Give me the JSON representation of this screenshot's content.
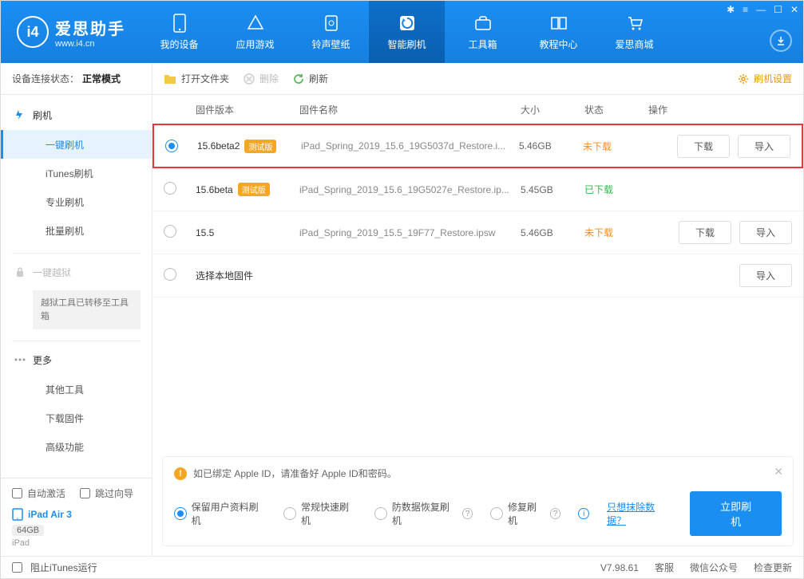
{
  "app": {
    "title": "爱思助手",
    "url": "www.i4.cn"
  },
  "window_buttons": [
    "✱",
    "≡",
    "—",
    "☐",
    "✕"
  ],
  "nav": [
    {
      "label": "我的设备"
    },
    {
      "label": "应用游戏"
    },
    {
      "label": "铃声壁纸"
    },
    {
      "label": "智能刷机",
      "active": true
    },
    {
      "label": "工具箱"
    },
    {
      "label": "教程中心"
    },
    {
      "label": "爱思商城"
    }
  ],
  "status": {
    "prefix": "设备连接状态：",
    "value": "正常模式"
  },
  "sidebar": {
    "group1": {
      "title": "刷机",
      "items": [
        "一键刷机",
        "iTunes刷机",
        "专业刷机",
        "批量刷机"
      ],
      "active": 0
    },
    "jailbreak": {
      "title": "一键越狱",
      "note": "越狱工具已转移至工具箱"
    },
    "more": {
      "title": "更多",
      "items": [
        "其他工具",
        "下载固件",
        "高级功能"
      ]
    },
    "auto_activate": "自动激活",
    "skip_guide": "跳过向导",
    "device": {
      "name": "iPad Air 3",
      "storage": "64GB",
      "type": "iPad"
    }
  },
  "toolbar": {
    "open": "打开文件夹",
    "delete": "删除",
    "refresh": "刷新",
    "settings": "刷机设置"
  },
  "table": {
    "headers": {
      "version": "固件版本",
      "name": "固件名称",
      "size": "大小",
      "status": "状态",
      "ops": "操作"
    },
    "rows": [
      {
        "selected": true,
        "version": "15.6beta2",
        "beta": "测试版",
        "name": "iPad_Spring_2019_15.6_19G5037d_Restore.i...",
        "size": "5.46GB",
        "status": "未下载",
        "status_class": "st-not",
        "download": "下载",
        "import": "导入",
        "highlight": true
      },
      {
        "selected": false,
        "version": "15.6beta",
        "beta": "测试版",
        "name": "iPad_Spring_2019_15.6_19G5027e_Restore.ip...",
        "size": "5.45GB",
        "status": "已下载",
        "status_class": "st-done"
      },
      {
        "selected": false,
        "version": "15.5",
        "name": "iPad_Spring_2019_15.5_19F77_Restore.ipsw",
        "size": "5.46GB",
        "status": "未下载",
        "status_class": "st-not",
        "download": "下载",
        "import": "导入"
      },
      {
        "selected": false,
        "local": "选择本地固件",
        "import": "导入"
      }
    ]
  },
  "info": {
    "warning": "如已绑定 Apple ID，请准备好 Apple ID和密码。",
    "options": [
      "保留用户资料刷机",
      "常规快速刷机",
      "防数据恢复刷机",
      "修复刷机"
    ],
    "selected": 0,
    "erase_link": "只想抹除数据？",
    "action": "立即刷机"
  },
  "footer": {
    "block_itunes": "阻止iTunes运行",
    "version": "V7.98.61",
    "links": [
      "客服",
      "微信公众号",
      "检查更新"
    ]
  }
}
